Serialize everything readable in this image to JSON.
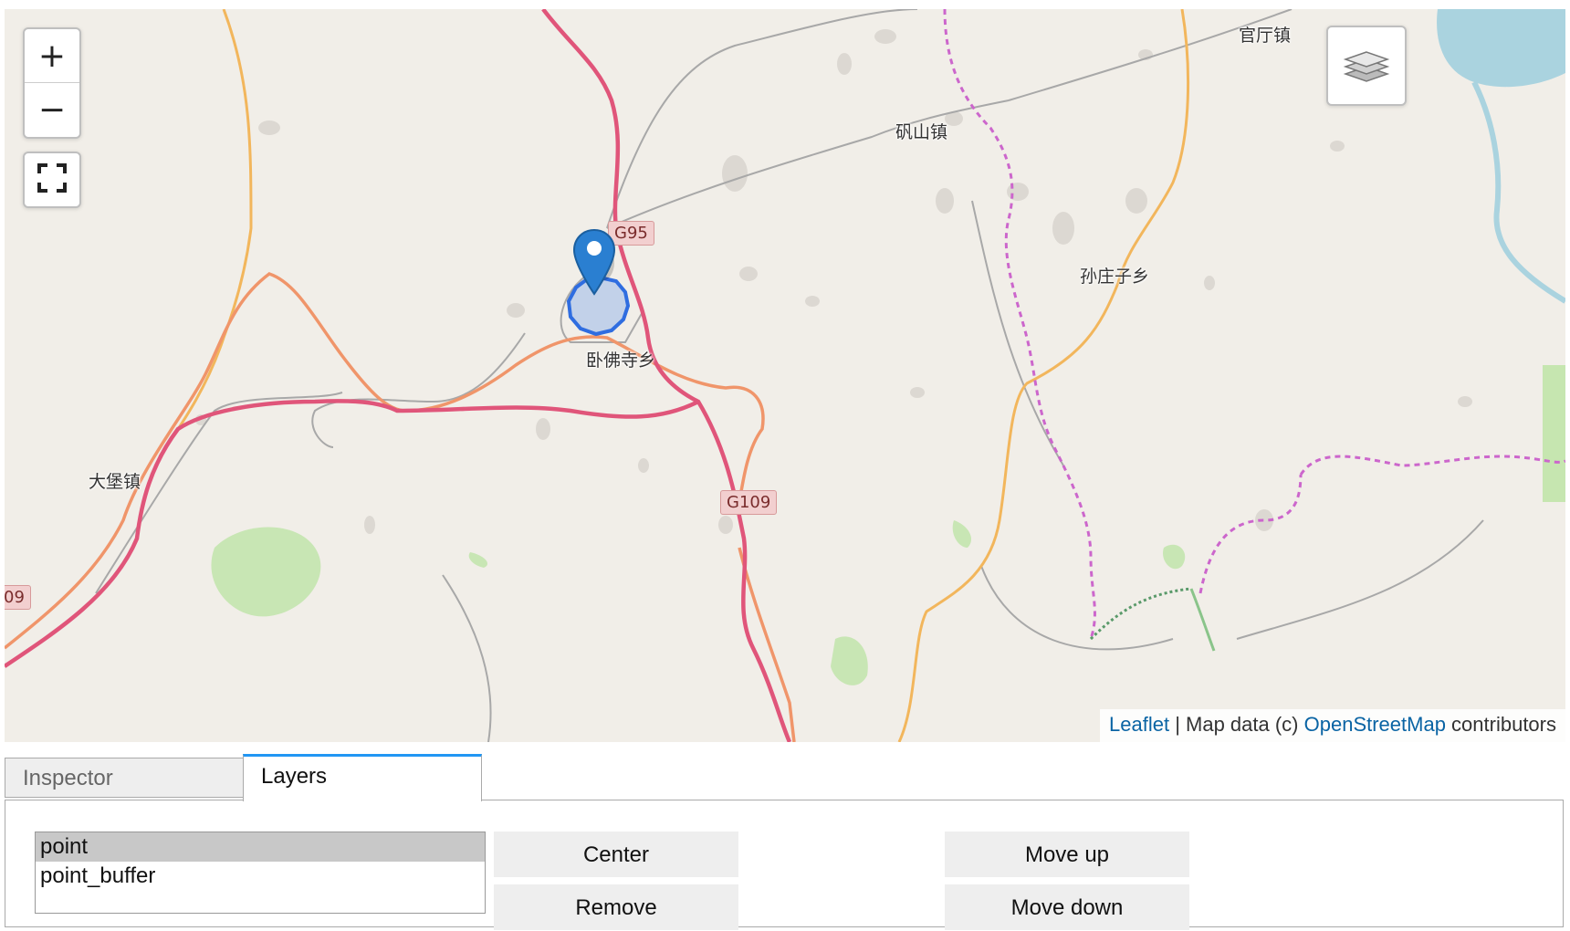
{
  "map": {
    "places": {
      "guanting": "官厅镇",
      "fanshan": "矾山镇",
      "sunzhuangzi": "孙庄子乡",
      "wofosi": "卧佛寺乡",
      "dabao": "大堡镇"
    },
    "shields": {
      "g95": "G95",
      "g109": "G109",
      "g109_partial": "09"
    },
    "controls": {
      "zoom_in": "+",
      "zoom_out": "−",
      "fullscreen_icon": "fullscreen-icon",
      "layers_icon": "layers-icon"
    },
    "attribution": {
      "leaflet": "Leaflet",
      "sep": " | Map data (c) ",
      "osm": "OpenStreetMap",
      "tail": " contributors"
    },
    "colors": {
      "background": "#f1eee8",
      "motorway": "#e0557a",
      "primary_road": "#f0956a",
      "secondary_road": "#f2b65c",
      "boundary": "#cc66cc",
      "buffer_stroke": "#2f6de0",
      "marker": "#2a7fd1"
    }
  },
  "tabs": [
    {
      "label": "Inspector"
    },
    {
      "label": "Layers"
    }
  ],
  "active_tab": "Layers",
  "layers": {
    "items": [
      {
        "label": "point",
        "selected": true
      },
      {
        "label": "point_buffer",
        "selected": false
      }
    ]
  },
  "buttons": {
    "center": "Center",
    "remove": "Remove",
    "move_up": "Move up",
    "move_down": "Move down"
  }
}
